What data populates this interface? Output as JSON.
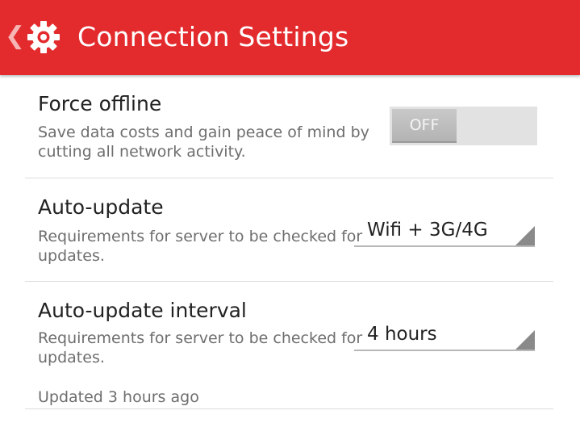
{
  "header": {
    "title": "Connection Settings",
    "back_icon": "chevron-left-icon",
    "app_icon": "gear-icon",
    "background_color": "#e32b2e"
  },
  "settings": [
    {
      "title": "Force offline",
      "description": "Save data costs and gain peace of mind by cutting all network activity.",
      "control": "toggle",
      "value": "OFF"
    },
    {
      "title": "Auto-update",
      "description": "Requirements for server to be checked for updates.",
      "control": "dropdown",
      "value": "Wifi + 3G/4G"
    },
    {
      "title": "Auto-update interval",
      "description": "Requirements for server to be checked for updates.",
      "control": "dropdown",
      "value": "4 hours",
      "footnote": "Updated 3 hours ago"
    }
  ]
}
